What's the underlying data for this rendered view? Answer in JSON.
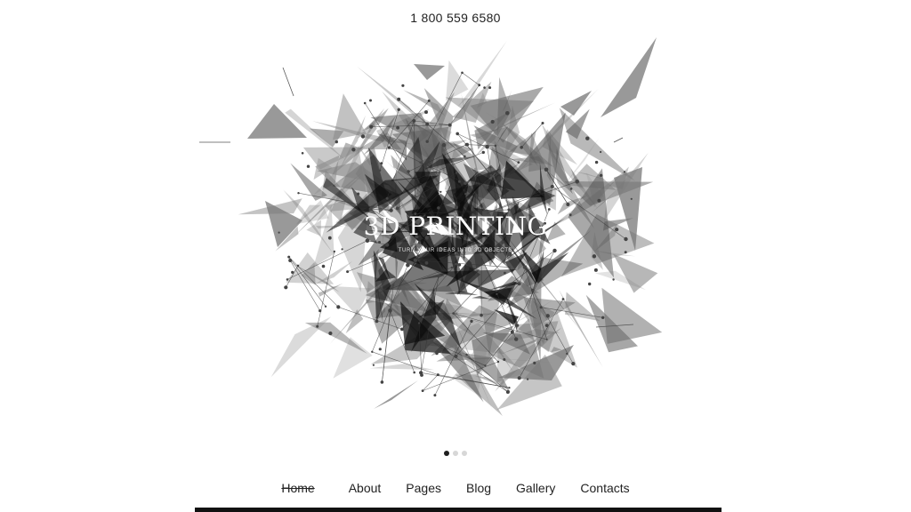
{
  "header": {
    "phone": "1 800 559 6580"
  },
  "hero": {
    "title": "3D PRINTING",
    "subtitle": "TURN YOUR IDEAS INTO 3D OBJECTS",
    "slides_total": 3,
    "active_slide": 1
  },
  "nav": {
    "items": [
      {
        "label": "Home",
        "current": true
      },
      {
        "label": "About",
        "current": false
      },
      {
        "label": "Pages",
        "current": false
      },
      {
        "label": "Blog",
        "current": false
      },
      {
        "label": "Gallery",
        "current": false
      },
      {
        "label": "Contacts",
        "current": false
      }
    ]
  },
  "colors": {
    "background": "#ffffff",
    "text": "#222222",
    "accent_dark": "#111111",
    "dot_inactive": "#d7d7d7"
  }
}
